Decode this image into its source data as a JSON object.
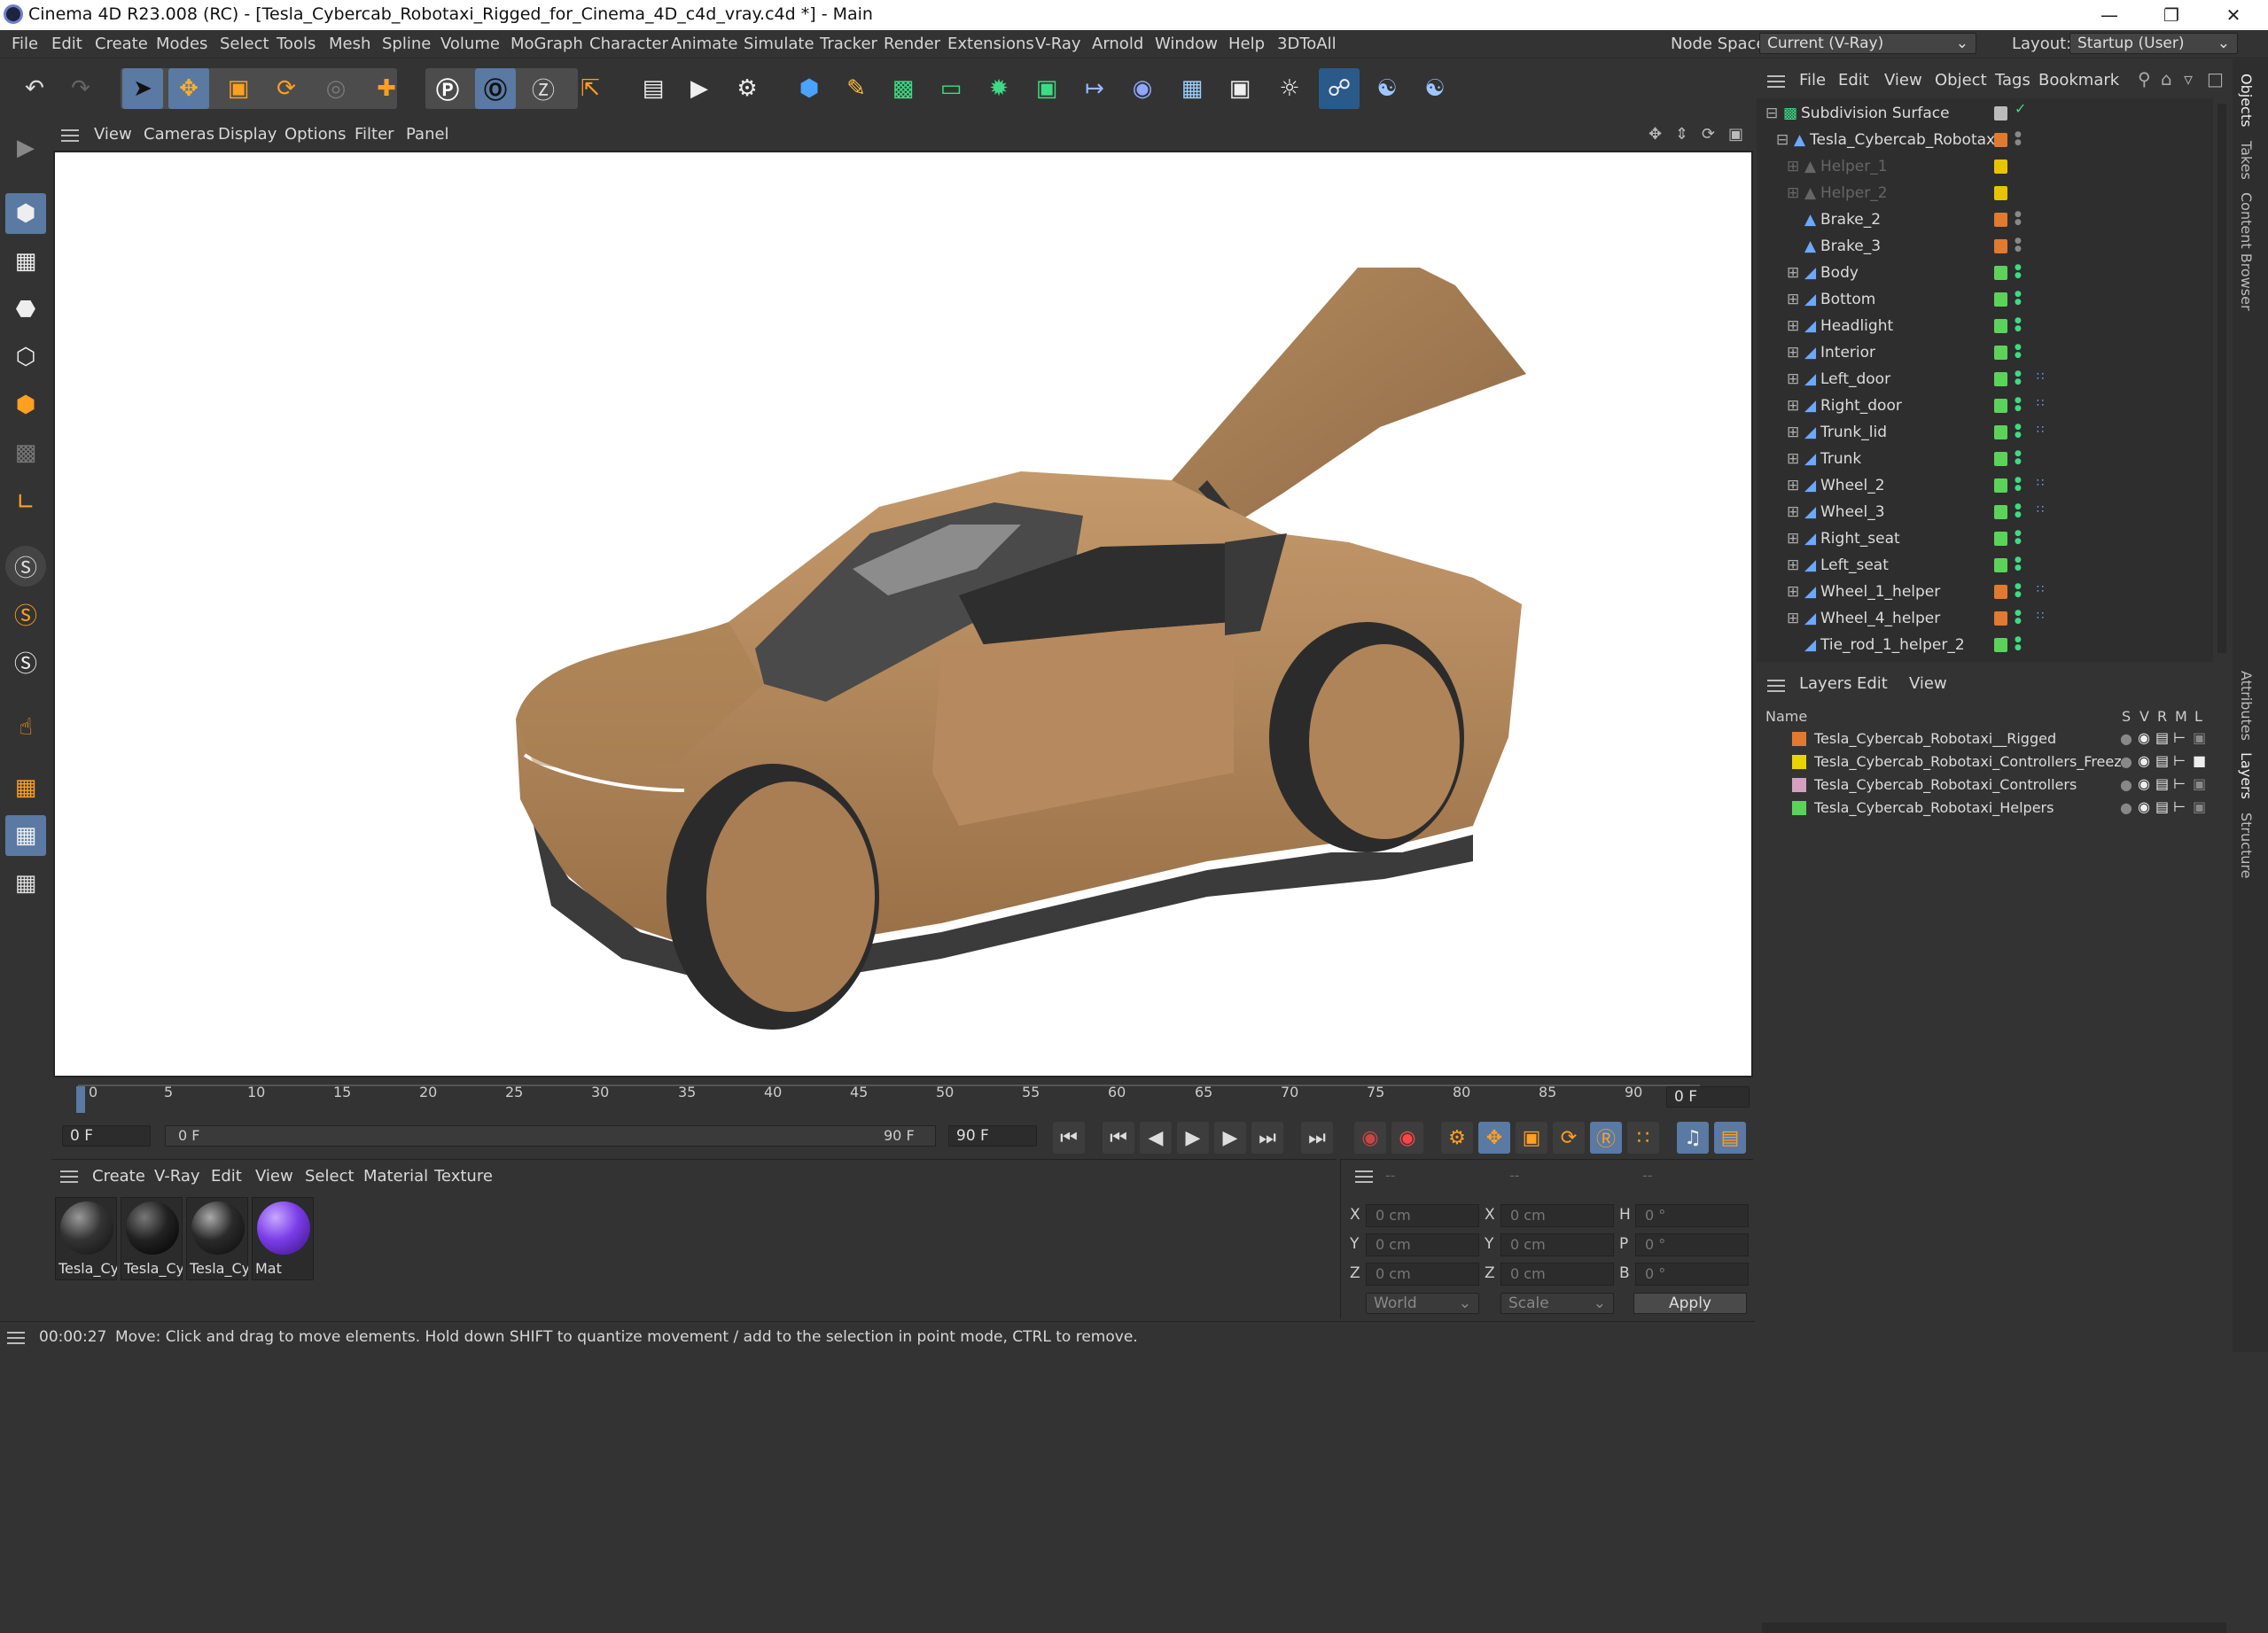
{
  "titlebar": {
    "title": "Cinema 4D R23.008 (RC) - [Tesla_Cybercab_Robotaxi_Rigged_for_Cinema_4D_c4d_vray.c4d *] - Main"
  },
  "menu": [
    "File",
    "Edit",
    "Create",
    "Modes",
    "Select",
    "Tools",
    "Mesh",
    "Spline",
    "Volume",
    "MoGraph",
    "Character",
    "Animate",
    "Simulate",
    "Tracker",
    "Render",
    "Extensions",
    "V-Ray",
    "Arnold",
    "Window",
    "Help",
    "3DToAll"
  ],
  "nodespace": {
    "label": "Node Space:",
    "value": "Current (V-Ray)"
  },
  "layout": {
    "label": "Layout:",
    "value": "Startup (User)"
  },
  "viewport_menu": [
    "View",
    "Cameras",
    "Display",
    "Options",
    "Filter",
    "Panel"
  ],
  "timeline": {
    "ticks": [
      "0",
      "5",
      "10",
      "15",
      "20",
      "25",
      "30",
      "35",
      "40",
      "45",
      "50",
      "55",
      "60",
      "65",
      "70",
      "75",
      "80",
      "85",
      "90"
    ],
    "current_frame": "0 F"
  },
  "transport": {
    "start_frame": "0 F",
    "range_start": "0 F",
    "range_end": "90 F",
    "end_frame": "90 F"
  },
  "material_menu": [
    "Create",
    "V-Ray",
    "Edit",
    "View",
    "Select",
    "Material",
    "Texture"
  ],
  "materials": [
    {
      "label": "Tesla_Cy"
    },
    {
      "label": "Tesla_Cy"
    },
    {
      "label": "Tesla_Cy"
    },
    {
      "label": "Mat"
    }
  ],
  "coords": {
    "placeholder": "--",
    "rows": [
      {
        "a1": "X",
        "v1": "0 cm",
        "a2": "X",
        "v2": "0 cm",
        "a3": "H",
        "v3": "0 °"
      },
      {
        "a1": "Y",
        "v1": "0 cm",
        "a2": "Y",
        "v2": "0 cm",
        "a3": "P",
        "v3": "0 °"
      },
      {
        "a1": "Z",
        "v1": "0 cm",
        "a2": "Z",
        "v2": "0 cm",
        "a3": "B",
        "v3": "0 °"
      }
    ],
    "space": "World",
    "mode": "Scale",
    "apply": "Apply"
  },
  "status": {
    "time": "00:00:27",
    "message": "Move: Click and drag to move elements. Hold down SHIFT to quantize movement / add to the selection in point mode, CTRL to remove."
  },
  "object_menu": [
    "File",
    "Edit",
    "View",
    "Object",
    "Tags",
    "Bookmark"
  ],
  "objects": [
    {
      "name": "Subdivision Surface",
      "color": "#bbbbbb",
      "indent": 0
    },
    {
      "name": "Tesla_Cybercab_Robotaxi",
      "color": "#e07a30",
      "indent": 1
    },
    {
      "name": "Helper_1",
      "color": "#e8c400",
      "indent": 2,
      "dim": true
    },
    {
      "name": "Helper_2",
      "color": "#e8c400",
      "indent": 2,
      "dim": true
    },
    {
      "name": "Brake_2",
      "color": "#e07a30",
      "indent": 2
    },
    {
      "name": "Brake_3",
      "color": "#e07a30",
      "indent": 2
    },
    {
      "name": "Body",
      "color": "#5bd35b",
      "indent": 2
    },
    {
      "name": "Bottom",
      "color": "#5bd35b",
      "indent": 2
    },
    {
      "name": "Headlight",
      "color": "#5bd35b",
      "indent": 2
    },
    {
      "name": "Interior",
      "color": "#5bd35b",
      "indent": 2
    },
    {
      "name": "Left_door",
      "color": "#5bd35b",
      "indent": 2
    },
    {
      "name": "Right_door",
      "color": "#5bd35b",
      "indent": 2
    },
    {
      "name": "Trunk_lid",
      "color": "#5bd35b",
      "indent": 2
    },
    {
      "name": "Trunk",
      "color": "#5bd35b",
      "indent": 2
    },
    {
      "name": "Wheel_2",
      "color": "#5bd35b",
      "indent": 2
    },
    {
      "name": "Wheel_3",
      "color": "#5bd35b",
      "indent": 2
    },
    {
      "name": "Right_seat",
      "color": "#5bd35b",
      "indent": 2
    },
    {
      "name": "Left_seat",
      "color": "#5bd35b",
      "indent": 2
    },
    {
      "name": "Wheel_1_helper",
      "color": "#e07a30",
      "indent": 2
    },
    {
      "name": "Wheel_4_helper",
      "color": "#e07a30",
      "indent": 2
    },
    {
      "name": "Tie_rod_1_helper_2",
      "color": "#5bd35b",
      "indent": 2
    }
  ],
  "layers_menu": [
    "Layers",
    "Edit",
    "View"
  ],
  "layers_header": {
    "name": "Name",
    "cols": [
      "S",
      "V",
      "R",
      "M",
      "L"
    ]
  },
  "layers": [
    {
      "name": "Tesla_Cybercab_Robotaxi__Rigged",
      "color": "#e07a30"
    },
    {
      "name": "Tesla_Cybercab_Robotaxi_Controllers_Freeze",
      "color": "#e8d400"
    },
    {
      "name": "Tesla_Cybercab_Robotaxi_Controllers",
      "color": "#d4a0c0"
    },
    {
      "name": "Tesla_Cybercab_Robotaxi_Helpers",
      "color": "#5bd35b"
    }
  ],
  "side_tabs": [
    "Objects",
    "Takes",
    "Content Browser",
    "Attributes",
    "Layers",
    "Structure"
  ]
}
